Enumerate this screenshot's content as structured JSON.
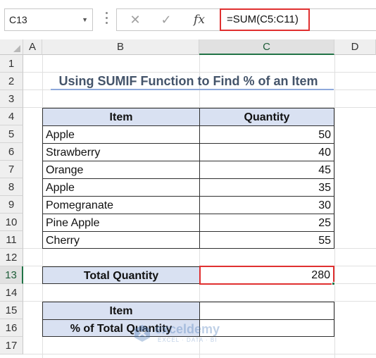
{
  "formula_bar": {
    "name_box": "C13",
    "cancel_symbol": "✕",
    "enter_symbol": "✓",
    "fx_symbol": "fx",
    "formula": "=SUM(C5:C11)"
  },
  "columns": [
    "A",
    "B",
    "C",
    "D"
  ],
  "selected_column": "C",
  "rows": [
    "1",
    "2",
    "3",
    "4",
    "5",
    "6",
    "7",
    "8",
    "9",
    "10",
    "11",
    "12",
    "13",
    "14",
    "15",
    "16",
    "17"
  ],
  "selected_row": "13",
  "sheet": {
    "title": "Using SUMIF Function to Find % of an Item",
    "table": {
      "headers": [
        "Item",
        "Quantity"
      ],
      "rows": [
        [
          "Apple",
          "50"
        ],
        [
          "Strawberry",
          "40"
        ],
        [
          "Orange",
          "45"
        ],
        [
          "Apple",
          "35"
        ],
        [
          "Pomegranate",
          "30"
        ],
        [
          "Pine Apple",
          "25"
        ],
        [
          "Cherry",
          "55"
        ]
      ]
    },
    "total_label": "Total Quantity",
    "total_value": "280",
    "lookup": {
      "item_label": "Item",
      "item_value": "",
      "percent_label": "% of Total Quantity",
      "percent_value": ""
    }
  },
  "watermark": {
    "name": "exceldemy",
    "tagline": "EXCEL · DATA · BI"
  },
  "colors": {
    "header_fill": "#d9e1f2",
    "selection_green": "#217346",
    "highlight_red": "#e03030",
    "title_color": "#44546a"
  }
}
